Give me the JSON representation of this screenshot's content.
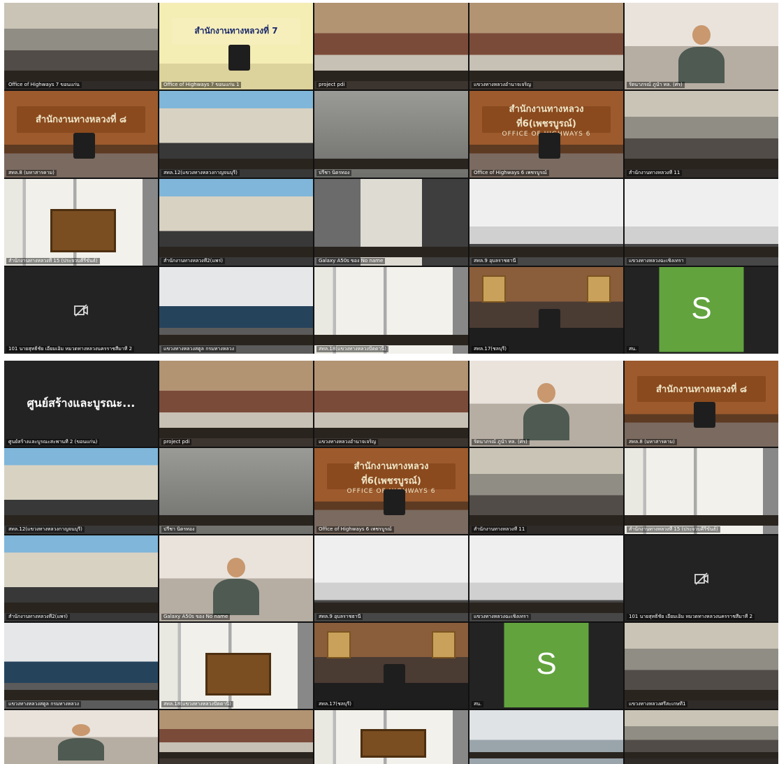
{
  "top_grid": {
    "tiles": [
      {
        "label": "Office of Highways 7 ขอนแก่น",
        "style": "conf"
      },
      {
        "label": "Office of Highways 7 ขอนแก่น 1",
        "style": "yellow",
        "sign": "สำนักงานทางหลวงที่ 7"
      },
      {
        "label": "project pdi",
        "style": "hall"
      },
      {
        "label": "แขวงทางหลวงอำนาจเจริญ",
        "style": "hall"
      },
      {
        "label": "รัตนาภรณ์ ภูนำ ทล. (ศร)",
        "style": "person"
      },
      {
        "label": "สทล.8 (มหาสารคาม)",
        "style": "wood",
        "sign": "สำนักงานทางหลวงที่ ๘"
      },
      {
        "label": "สทล.12(แขวงทางหลวงกาญจนบุรี)",
        "style": "blue"
      },
      {
        "label": "ปรีชา นิตรทอง",
        "style": "blur"
      },
      {
        "label": "Office of Highways 6 เพชรบูรณ์",
        "style": "brown",
        "sign": "สำนักงานทางหลวงที่6(เพชรบูรณ์)",
        "sign_sub": "OFFICE OF HIGHWAYS 6"
      },
      {
        "label": "สำนักงานทางหลวงที่ 11",
        "style": "conf"
      },
      {
        "label": "สำนักงานทางหลวงที่ 15 (ประจวบคีรีขันธ์)",
        "style": "window"
      },
      {
        "label": "สำนักงานทางหลวงที่2(แพร่)",
        "style": "blue"
      },
      {
        "label": "Galaxy A50s ของ No name",
        "style": "office"
      },
      {
        "label": "สทล.9 อุบลราชธานี",
        "style": "white"
      },
      {
        "label": "แขวงทางหลวงฉะเชิงเทรา",
        "style": "white"
      },
      {
        "label": "101 นายสุทธิ์ชัย เอี่ยมเอิ่ม หมวดทางหลวงนครราชสีมาที่ 2",
        "style": "camoff"
      },
      {
        "label": "แขวงทางหลวงสตูล กรมทางหลวง",
        "style": "floor"
      },
      {
        "label": "สทล.18(แขวงทางหลวงปัตตานี)",
        "style": "window"
      },
      {
        "label": "สทล.17(ชลบุรี)",
        "style": "gallery"
      },
      {
        "label": "สน.",
        "style": "avatar",
        "avatar_letter": "S"
      }
    ]
  },
  "bottom_grid": {
    "tiles": [
      {
        "label": "ศูนย์สร้างและบูรณะสะพานที่ 2 (ขอนแก่น)",
        "style": "name",
        "name_card": "ศูนย์สร้างและบูรณะ..."
      },
      {
        "label": "project pdi",
        "style": "hall"
      },
      {
        "label": "แขวงทางหลวงอำนาจเจริญ",
        "style": "hall"
      },
      {
        "label": "รัตนาภรณ์ ภูนำ ทล. (ศร)",
        "style": "person"
      },
      {
        "label": "สทล.8 (มหาสารคาม)",
        "style": "wood",
        "sign": "สำนักงานทางหลวงที่ ๘"
      },
      {
        "label": "สทล.12(แขวงทางหลวงกาญจนบุรี)",
        "style": "blue"
      },
      {
        "label": "ปรีชา นิตรทอง",
        "style": "blur"
      },
      {
        "label": "Office of Highways 6 เพชรบูรณ์",
        "style": "brown",
        "sign": "สำนักงานทางหลวงที่6(เพชรบูรณ์)",
        "sign_sub": "OFFICE OF HIGHWAYS 6"
      },
      {
        "label": "สำนักงานทางหลวงที่ 11",
        "style": "conf"
      },
      {
        "label": "สำนักงานทางหลวงที่ 15 (ประจวบคีรีขันธ์)",
        "style": "window"
      },
      {
        "label": "สำนักงานทางหลวงที่2(แพร่)",
        "style": "blue"
      },
      {
        "label": "Galaxy A50s ของ No name",
        "style": "person"
      },
      {
        "label": "สทล.9 อุบลราชธานี",
        "style": "white"
      },
      {
        "label": "แขวงทางหลวงฉะเชิงเทรา",
        "style": "white"
      },
      {
        "label": "101 นายสุทธิ์ชัย เอี่ยมเอิ่ม หมวดทางหลวงนครราชสีมาที่ 2",
        "style": "camoff"
      },
      {
        "label": "แขวงทางหลวงสตูล กรมทางหลวง",
        "style": "floor"
      },
      {
        "label": "สทล.18(แขวงทางหลวงปัตตานี)",
        "style": "window"
      },
      {
        "label": "สทล.17(ชลบุรี)",
        "style": "gallery"
      },
      {
        "label": "สน.",
        "style": "avatar",
        "avatar_letter": "S"
      },
      {
        "label": "แขวงทางหลวงศรีสะเกษที่1",
        "style": "conf"
      },
      {
        "label": "",
        "style": "person"
      },
      {
        "label": "",
        "style": "hall"
      },
      {
        "label": "",
        "style": "window"
      },
      {
        "label": "",
        "style": "street"
      },
      {
        "label": "",
        "style": "conf"
      }
    ]
  },
  "icons": {
    "camera_off": "camera-off-icon"
  },
  "colors": {
    "avatar_green": "#62a33e",
    "grid_bg": "#111111"
  }
}
